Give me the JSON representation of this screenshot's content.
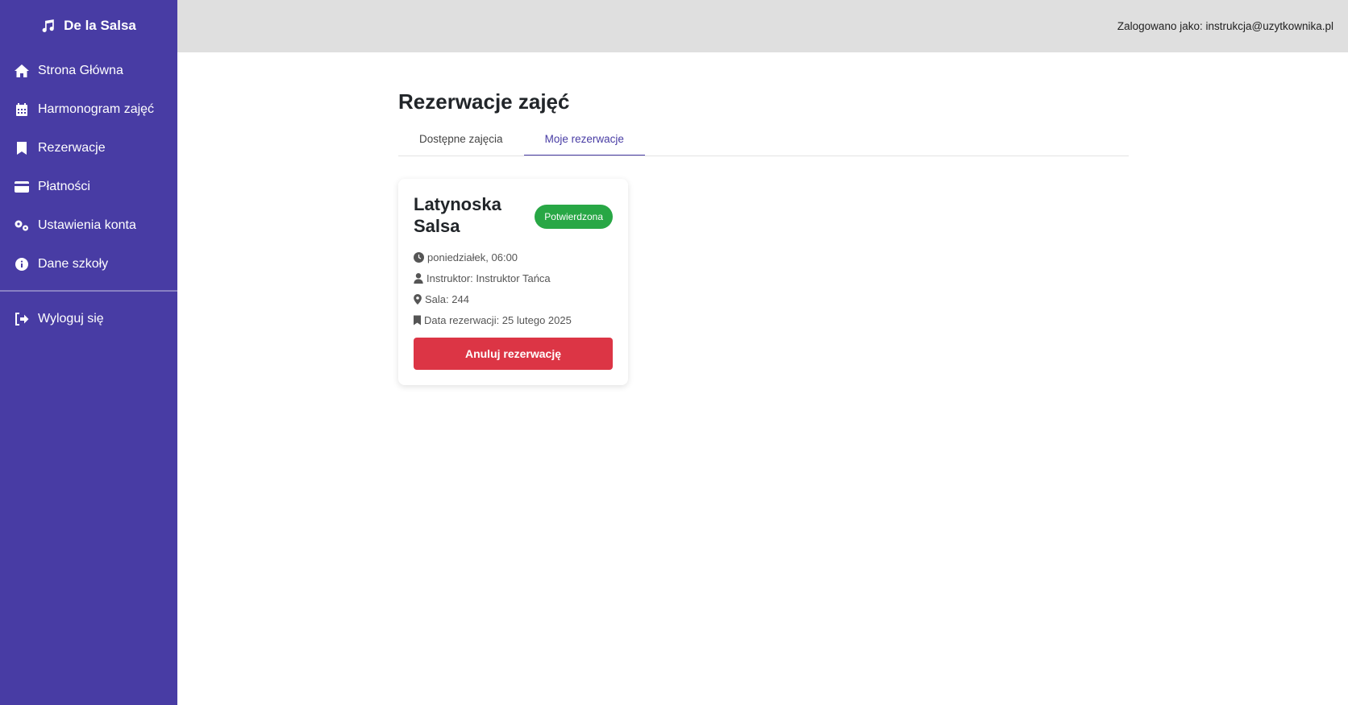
{
  "brand": {
    "name": "De la Salsa",
    "icon": "music-note-icon"
  },
  "sidebar": {
    "items": [
      {
        "label": "Strona Główna",
        "icon": "home-icon"
      },
      {
        "label": "Harmonogram zajęć",
        "icon": "calendar-icon"
      },
      {
        "label": "Rezerwacje",
        "icon": "bookmark-icon"
      },
      {
        "label": "Płatności",
        "icon": "credit-card-icon"
      },
      {
        "label": "Ustawienia konta",
        "icon": "gears-icon"
      },
      {
        "label": "Dane szkoły",
        "icon": "info-icon"
      }
    ],
    "logout": {
      "label": "Wyloguj się",
      "icon": "sign-out-icon"
    }
  },
  "topbar": {
    "user_text": "Zalogowano jako: instrukcja@uzytkownika.pl"
  },
  "main": {
    "title": "Rezerwacje zajęć",
    "tabs": [
      {
        "label": "Dostępne zajęcia",
        "active": false
      },
      {
        "label": "Moje rezerwacje",
        "active": true
      }
    ]
  },
  "reservation": {
    "title": "Latynoska Salsa",
    "status": "Potwierdzona",
    "time": "poniedziałek, 06:00",
    "instructor": "Instruktor: Instruktor Tańca",
    "room": "Sala: 244",
    "reservation_date": "Data rezerwacji: 25 lutego 2025",
    "cancel_label": "Anuluj rezerwację"
  },
  "colors": {
    "sidebar": "#483ca4",
    "topbar": "#dfdfdf",
    "badge": "#28a745",
    "danger": "#dc3545",
    "accent": "#483ca4"
  }
}
